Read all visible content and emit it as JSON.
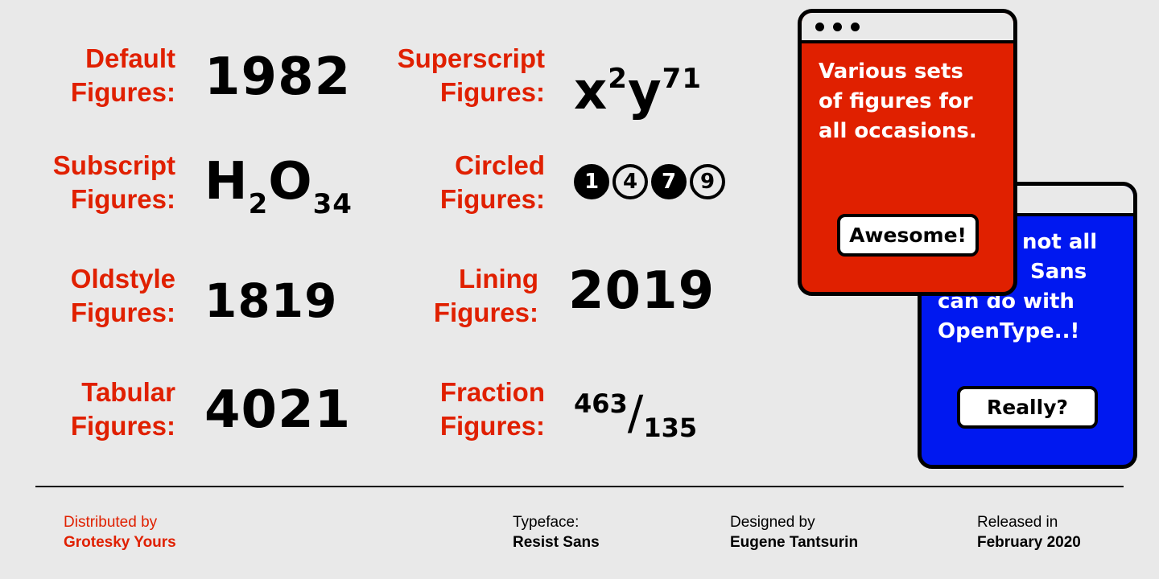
{
  "specimens": [
    {
      "label_line1": "Default",
      "label_line2": "Figures:",
      "sample": "1982"
    },
    {
      "label_line1": "Superscript",
      "label_line2": "Figures:",
      "base1": "x",
      "sup1": "2",
      "base2": "y",
      "sup2": "71"
    },
    {
      "label_line1": "Subscript",
      "label_line2": "Figures:",
      "base1": "H",
      "sub1": "2",
      "base2": "O",
      "sub2": "34"
    },
    {
      "label_line1": "Circled",
      "label_line2": "Figures:",
      "circles": [
        {
          "digit": "1",
          "style": "filled"
        },
        {
          "digit": "4",
          "style": "outline"
        },
        {
          "digit": "7",
          "style": "filled"
        },
        {
          "digit": "9",
          "style": "outline"
        }
      ]
    },
    {
      "label_line1": "Oldstyle",
      "label_line2": "Figures:",
      "sample": "1819"
    },
    {
      "label_line1": "Lining",
      "label_line2": "Figures:",
      "sample": "2019"
    },
    {
      "label_line1": "Tabular",
      "label_line2": "Figures:",
      "sample": "4021"
    },
    {
      "label_line1": "Fraction",
      "label_line2": "Figures:",
      "numerator": "463",
      "slash": "/",
      "denominator": "135"
    }
  ],
  "windows": {
    "red": {
      "text_lines": [
        "Various sets",
        "of figures for",
        "all occasions."
      ],
      "button": "Awesome!",
      "color": "#e02000"
    },
    "blue": {
      "text_lines": [
        "And not all",
        "Resist Sans",
        "can do with",
        "OpenType..!"
      ],
      "visible_text_lines": [
        "not all",
        "Sans",
        "can do with",
        "OpenType..!"
      ],
      "button": "Really?",
      "color": "#0018f0"
    }
  },
  "footer": {
    "distributed_label": "Distributed by",
    "distributed_value": "Grotesky Yours",
    "typeface_label": "Typeface:",
    "typeface_value": "Resist Sans",
    "designed_label": "Designed by",
    "designed_value": "Eugene Tantsurin",
    "released_label": "Released in",
    "released_value": "February 2020"
  },
  "colors": {
    "accent_red": "#e02000",
    "blue": "#0018f0",
    "background": "#e9e9e9",
    "text": "#000000"
  }
}
